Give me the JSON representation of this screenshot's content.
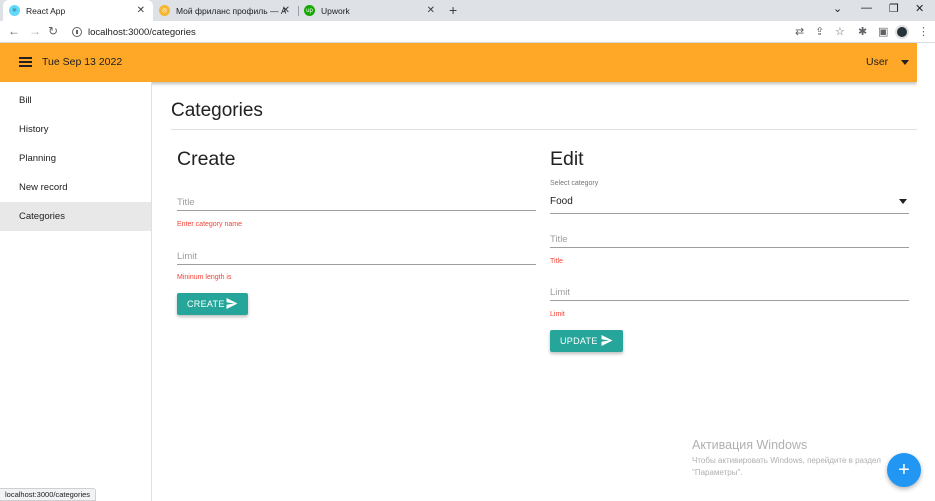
{
  "browser": {
    "tabs": [
      {
        "title": "React App",
        "icon": "react-icon",
        "active": true
      },
      {
        "title": "Мой фриланс профиль — Алди",
        "icon": "freelance-profile-icon",
        "active": false
      },
      {
        "title": "Upwork",
        "icon": "upwork-icon",
        "active": false
      }
    ],
    "address": "localhost:3000/categories",
    "status_url": "localhost:3000/categories"
  },
  "header": {
    "date": "Tue Sep 13 2022",
    "user": "User",
    "accent_color": "#ffa726"
  },
  "sidebar": {
    "items": [
      {
        "label": "Bill"
      },
      {
        "label": "History"
      },
      {
        "label": "Planning"
      },
      {
        "label": "New record"
      },
      {
        "label": "Categories",
        "active": true
      }
    ]
  },
  "main": {
    "page_title": "Categories",
    "create": {
      "heading": "Create",
      "title_placeholder": "Title",
      "title_helper": "Enter category name",
      "limit_placeholder": "Limit",
      "limit_helper": "Mininum length is",
      "button_label": "CREATE"
    },
    "edit": {
      "heading": "Edit",
      "select_label": "Select category",
      "selected_category": "Food",
      "title_placeholder": "Title",
      "title_helper": "Title",
      "limit_placeholder": "Limit",
      "limit_helper": "Limit",
      "button_label": "UPDATE"
    },
    "button_color": "#26a69a"
  },
  "overlay": {
    "activation_title": "Активация Windows",
    "activation_text": "Чтобы активировать Windows, перейдите в раздел \"Параметры\".",
    "fab_icon": "plus-icon"
  }
}
